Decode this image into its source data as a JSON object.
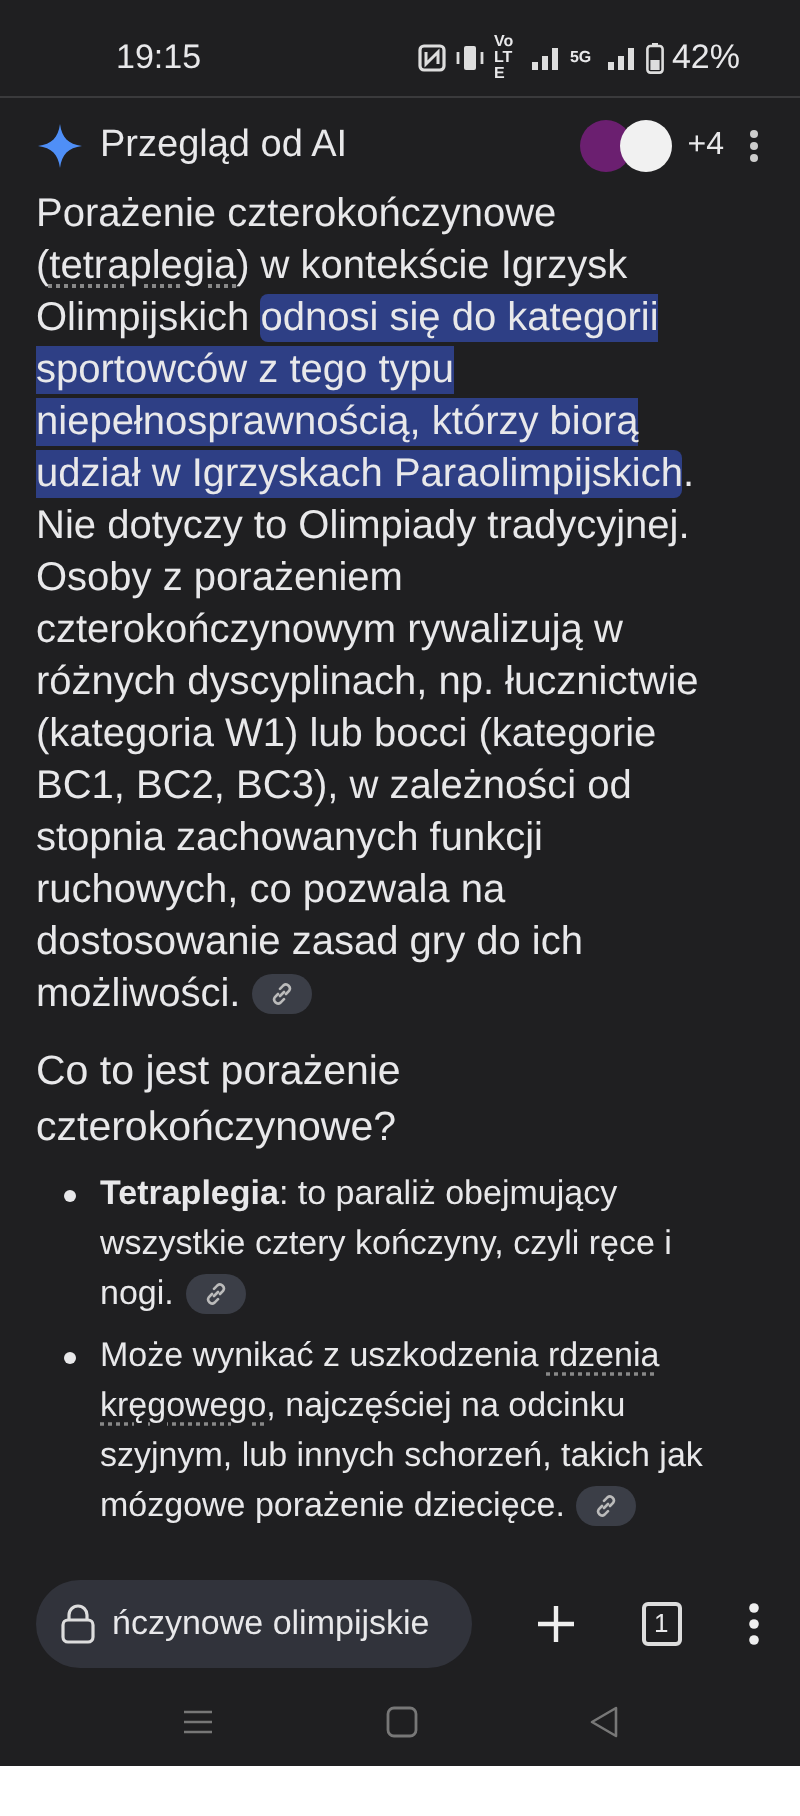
{
  "status_bar": {
    "time": "19:15",
    "volte": "VoLTE",
    "network": "5G",
    "battery": "42%"
  },
  "overview": {
    "title": "Przegląd od AI",
    "sources_more": "+4",
    "paragraph": [
      {
        "text": "Porażenie czterokończynowe (",
        "kind": "text"
      },
      {
        "text": "tetraplegia",
        "kind": "term"
      },
      {
        "text": ") w kontekście Igrzysk Olimpijskich ",
        "kind": "text"
      },
      {
        "text": "odnosi się do kategorii sportowców z tego typu niepełnosprawnością, którzy biorą udział w Igrzyskach Paraolimpijskich",
        "kind": "highlight"
      },
      {
        "text": ". Nie dotyczy to Olimpiady tradycyjnej. Osoby z porażeniem czterokończynowym rywalizują w różnych dyscyplinach, np. łucznictwie (kategoria W1) lub bocci (kategorie BC1, BC2, BC3), w zależności od stopnia zachowanych funkcji ruchowych, co pozwala na dostosowanie zasad gry do ich możliwości.",
        "kind": "text"
      }
    ],
    "heading": "Co to jest porażenie czterokończynowe?",
    "bullets": [
      [
        {
          "text": "**Tetraplegia**: to paraliż obejmujący wszystkie cztery kończyny, czyli ręce i nogi.",
          "kind": "text"
        }
      ],
      [
        {
          "text": "Może wynikać z uszkodzenia ",
          "kind": "text"
        },
        {
          "text": "rdzenia kręgowego",
          "kind": "term"
        },
        {
          "text": ", najczęściej na odcinku szyjnym, lub innych schorzeń, takich jak mózgowe porażenie dziecięce.",
          "kind": "text"
        }
      ]
    ]
  },
  "address_bar": {
    "text": "ńczynowe olimpijskie",
    "tab_count": "1"
  }
}
